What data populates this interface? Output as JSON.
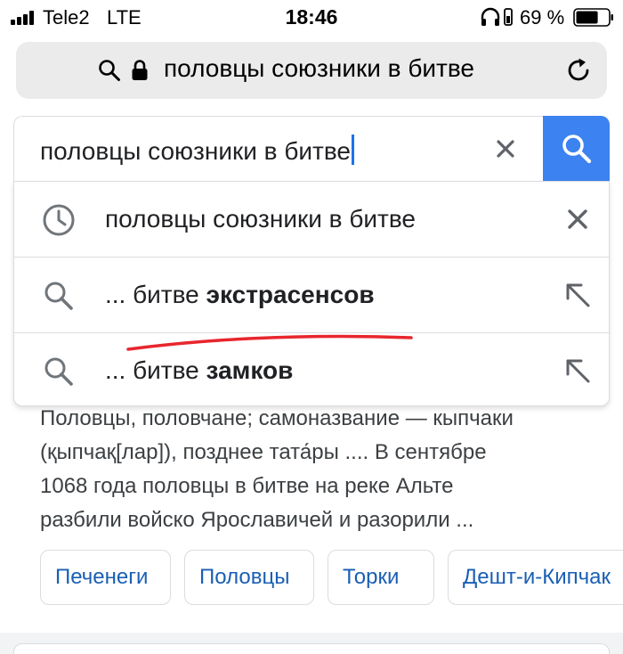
{
  "status_bar": {
    "carrier": "Tele2",
    "network": "LTE",
    "time": "18:46",
    "battery_percent": "69 %",
    "battery_level": 0.69,
    "icons": [
      "signal-icon",
      "headphones-icon",
      "battery-icon"
    ]
  },
  "address_bar": {
    "url_text": "половцы союзники в битве",
    "icons": [
      "search-icon",
      "lock-icon",
      "reload-icon"
    ]
  },
  "search": {
    "query": "половцы союзники в битве",
    "clear_icon": "close-icon",
    "submit_icon": "search-icon",
    "submit_color": "#3c82f0"
  },
  "suggestions": [
    {
      "icon": "history-icon",
      "prefix": "половцы союзники в битве",
      "bold": "",
      "action_icon": "close-icon"
    },
    {
      "icon": "search-icon",
      "prefix": "... битве ",
      "bold": "экстрасенсов",
      "action_icon": "arrow-up-left-icon"
    },
    {
      "icon": "search-icon",
      "prefix": "... битве ",
      "bold": "замков",
      "action_icon": "arrow-up-left-icon"
    }
  ],
  "annotation_color": "#e8262d",
  "result": {
    "snippet_lines": [
      "Половцы, половчане; самоназвание — кыпчаки",
      "(қыпчақ[лар]), позднее тата́ры .... В сентябре",
      "1068 года половцы в битве на реке Альте",
      "разбили войско Ярославичей и разорили ..."
    ],
    "chips": [
      "Печенеги",
      "Половцы",
      "Торки",
      "Дешт-и-Кипчак"
    ]
  }
}
